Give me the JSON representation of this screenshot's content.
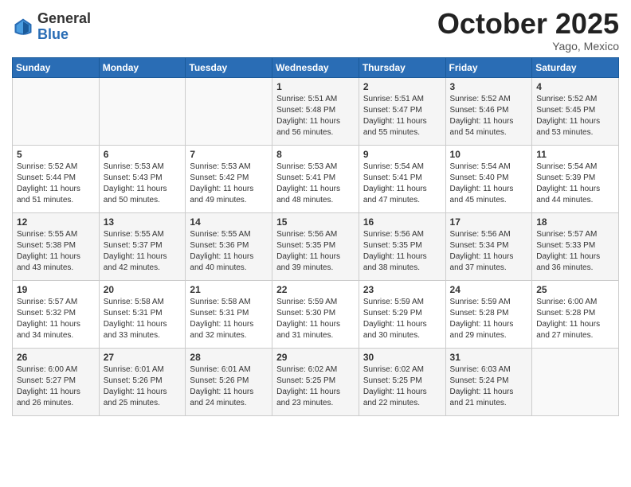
{
  "logo": {
    "general": "General",
    "blue": "Blue"
  },
  "title": "October 2025",
  "location": "Yago, Mexico",
  "days_of_week": [
    "Sunday",
    "Monday",
    "Tuesday",
    "Wednesday",
    "Thursday",
    "Friday",
    "Saturday"
  ],
  "weeks": [
    [
      {
        "num": "",
        "sunrise": "",
        "sunset": "",
        "daylight": ""
      },
      {
        "num": "",
        "sunrise": "",
        "sunset": "",
        "daylight": ""
      },
      {
        "num": "",
        "sunrise": "",
        "sunset": "",
        "daylight": ""
      },
      {
        "num": "1",
        "sunrise": "Sunrise: 5:51 AM",
        "sunset": "Sunset: 5:48 PM",
        "daylight": "Daylight: 11 hours and 56 minutes."
      },
      {
        "num": "2",
        "sunrise": "Sunrise: 5:51 AM",
        "sunset": "Sunset: 5:47 PM",
        "daylight": "Daylight: 11 hours and 55 minutes."
      },
      {
        "num": "3",
        "sunrise": "Sunrise: 5:52 AM",
        "sunset": "Sunset: 5:46 PM",
        "daylight": "Daylight: 11 hours and 54 minutes."
      },
      {
        "num": "4",
        "sunrise": "Sunrise: 5:52 AM",
        "sunset": "Sunset: 5:45 PM",
        "daylight": "Daylight: 11 hours and 53 minutes."
      }
    ],
    [
      {
        "num": "5",
        "sunrise": "Sunrise: 5:52 AM",
        "sunset": "Sunset: 5:44 PM",
        "daylight": "Daylight: 11 hours and 51 minutes."
      },
      {
        "num": "6",
        "sunrise": "Sunrise: 5:53 AM",
        "sunset": "Sunset: 5:43 PM",
        "daylight": "Daylight: 11 hours and 50 minutes."
      },
      {
        "num": "7",
        "sunrise": "Sunrise: 5:53 AM",
        "sunset": "Sunset: 5:42 PM",
        "daylight": "Daylight: 11 hours and 49 minutes."
      },
      {
        "num": "8",
        "sunrise": "Sunrise: 5:53 AM",
        "sunset": "Sunset: 5:41 PM",
        "daylight": "Daylight: 11 hours and 48 minutes."
      },
      {
        "num": "9",
        "sunrise": "Sunrise: 5:54 AM",
        "sunset": "Sunset: 5:41 PM",
        "daylight": "Daylight: 11 hours and 47 minutes."
      },
      {
        "num": "10",
        "sunrise": "Sunrise: 5:54 AM",
        "sunset": "Sunset: 5:40 PM",
        "daylight": "Daylight: 11 hours and 45 minutes."
      },
      {
        "num": "11",
        "sunrise": "Sunrise: 5:54 AM",
        "sunset": "Sunset: 5:39 PM",
        "daylight": "Daylight: 11 hours and 44 minutes."
      }
    ],
    [
      {
        "num": "12",
        "sunrise": "Sunrise: 5:55 AM",
        "sunset": "Sunset: 5:38 PM",
        "daylight": "Daylight: 11 hours and 43 minutes."
      },
      {
        "num": "13",
        "sunrise": "Sunrise: 5:55 AM",
        "sunset": "Sunset: 5:37 PM",
        "daylight": "Daylight: 11 hours and 42 minutes."
      },
      {
        "num": "14",
        "sunrise": "Sunrise: 5:55 AM",
        "sunset": "Sunset: 5:36 PM",
        "daylight": "Daylight: 11 hours and 40 minutes."
      },
      {
        "num": "15",
        "sunrise": "Sunrise: 5:56 AM",
        "sunset": "Sunset: 5:35 PM",
        "daylight": "Daylight: 11 hours and 39 minutes."
      },
      {
        "num": "16",
        "sunrise": "Sunrise: 5:56 AM",
        "sunset": "Sunset: 5:35 PM",
        "daylight": "Daylight: 11 hours and 38 minutes."
      },
      {
        "num": "17",
        "sunrise": "Sunrise: 5:56 AM",
        "sunset": "Sunset: 5:34 PM",
        "daylight": "Daylight: 11 hours and 37 minutes."
      },
      {
        "num": "18",
        "sunrise": "Sunrise: 5:57 AM",
        "sunset": "Sunset: 5:33 PM",
        "daylight": "Daylight: 11 hours and 36 minutes."
      }
    ],
    [
      {
        "num": "19",
        "sunrise": "Sunrise: 5:57 AM",
        "sunset": "Sunset: 5:32 PM",
        "daylight": "Daylight: 11 hours and 34 minutes."
      },
      {
        "num": "20",
        "sunrise": "Sunrise: 5:58 AM",
        "sunset": "Sunset: 5:31 PM",
        "daylight": "Daylight: 11 hours and 33 minutes."
      },
      {
        "num": "21",
        "sunrise": "Sunrise: 5:58 AM",
        "sunset": "Sunset: 5:31 PM",
        "daylight": "Daylight: 11 hours and 32 minutes."
      },
      {
        "num": "22",
        "sunrise": "Sunrise: 5:59 AM",
        "sunset": "Sunset: 5:30 PM",
        "daylight": "Daylight: 11 hours and 31 minutes."
      },
      {
        "num": "23",
        "sunrise": "Sunrise: 5:59 AM",
        "sunset": "Sunset: 5:29 PM",
        "daylight": "Daylight: 11 hours and 30 minutes."
      },
      {
        "num": "24",
        "sunrise": "Sunrise: 5:59 AM",
        "sunset": "Sunset: 5:28 PM",
        "daylight": "Daylight: 11 hours and 29 minutes."
      },
      {
        "num": "25",
        "sunrise": "Sunrise: 6:00 AM",
        "sunset": "Sunset: 5:28 PM",
        "daylight": "Daylight: 11 hours and 27 minutes."
      }
    ],
    [
      {
        "num": "26",
        "sunrise": "Sunrise: 6:00 AM",
        "sunset": "Sunset: 5:27 PM",
        "daylight": "Daylight: 11 hours and 26 minutes."
      },
      {
        "num": "27",
        "sunrise": "Sunrise: 6:01 AM",
        "sunset": "Sunset: 5:26 PM",
        "daylight": "Daylight: 11 hours and 25 minutes."
      },
      {
        "num": "28",
        "sunrise": "Sunrise: 6:01 AM",
        "sunset": "Sunset: 5:26 PM",
        "daylight": "Daylight: 11 hours and 24 minutes."
      },
      {
        "num": "29",
        "sunrise": "Sunrise: 6:02 AM",
        "sunset": "Sunset: 5:25 PM",
        "daylight": "Daylight: 11 hours and 23 minutes."
      },
      {
        "num": "30",
        "sunrise": "Sunrise: 6:02 AM",
        "sunset": "Sunset: 5:25 PM",
        "daylight": "Daylight: 11 hours and 22 minutes."
      },
      {
        "num": "31",
        "sunrise": "Sunrise: 6:03 AM",
        "sunset": "Sunset: 5:24 PM",
        "daylight": "Daylight: 11 hours and 21 minutes."
      },
      {
        "num": "",
        "sunrise": "",
        "sunset": "",
        "daylight": ""
      }
    ]
  ]
}
